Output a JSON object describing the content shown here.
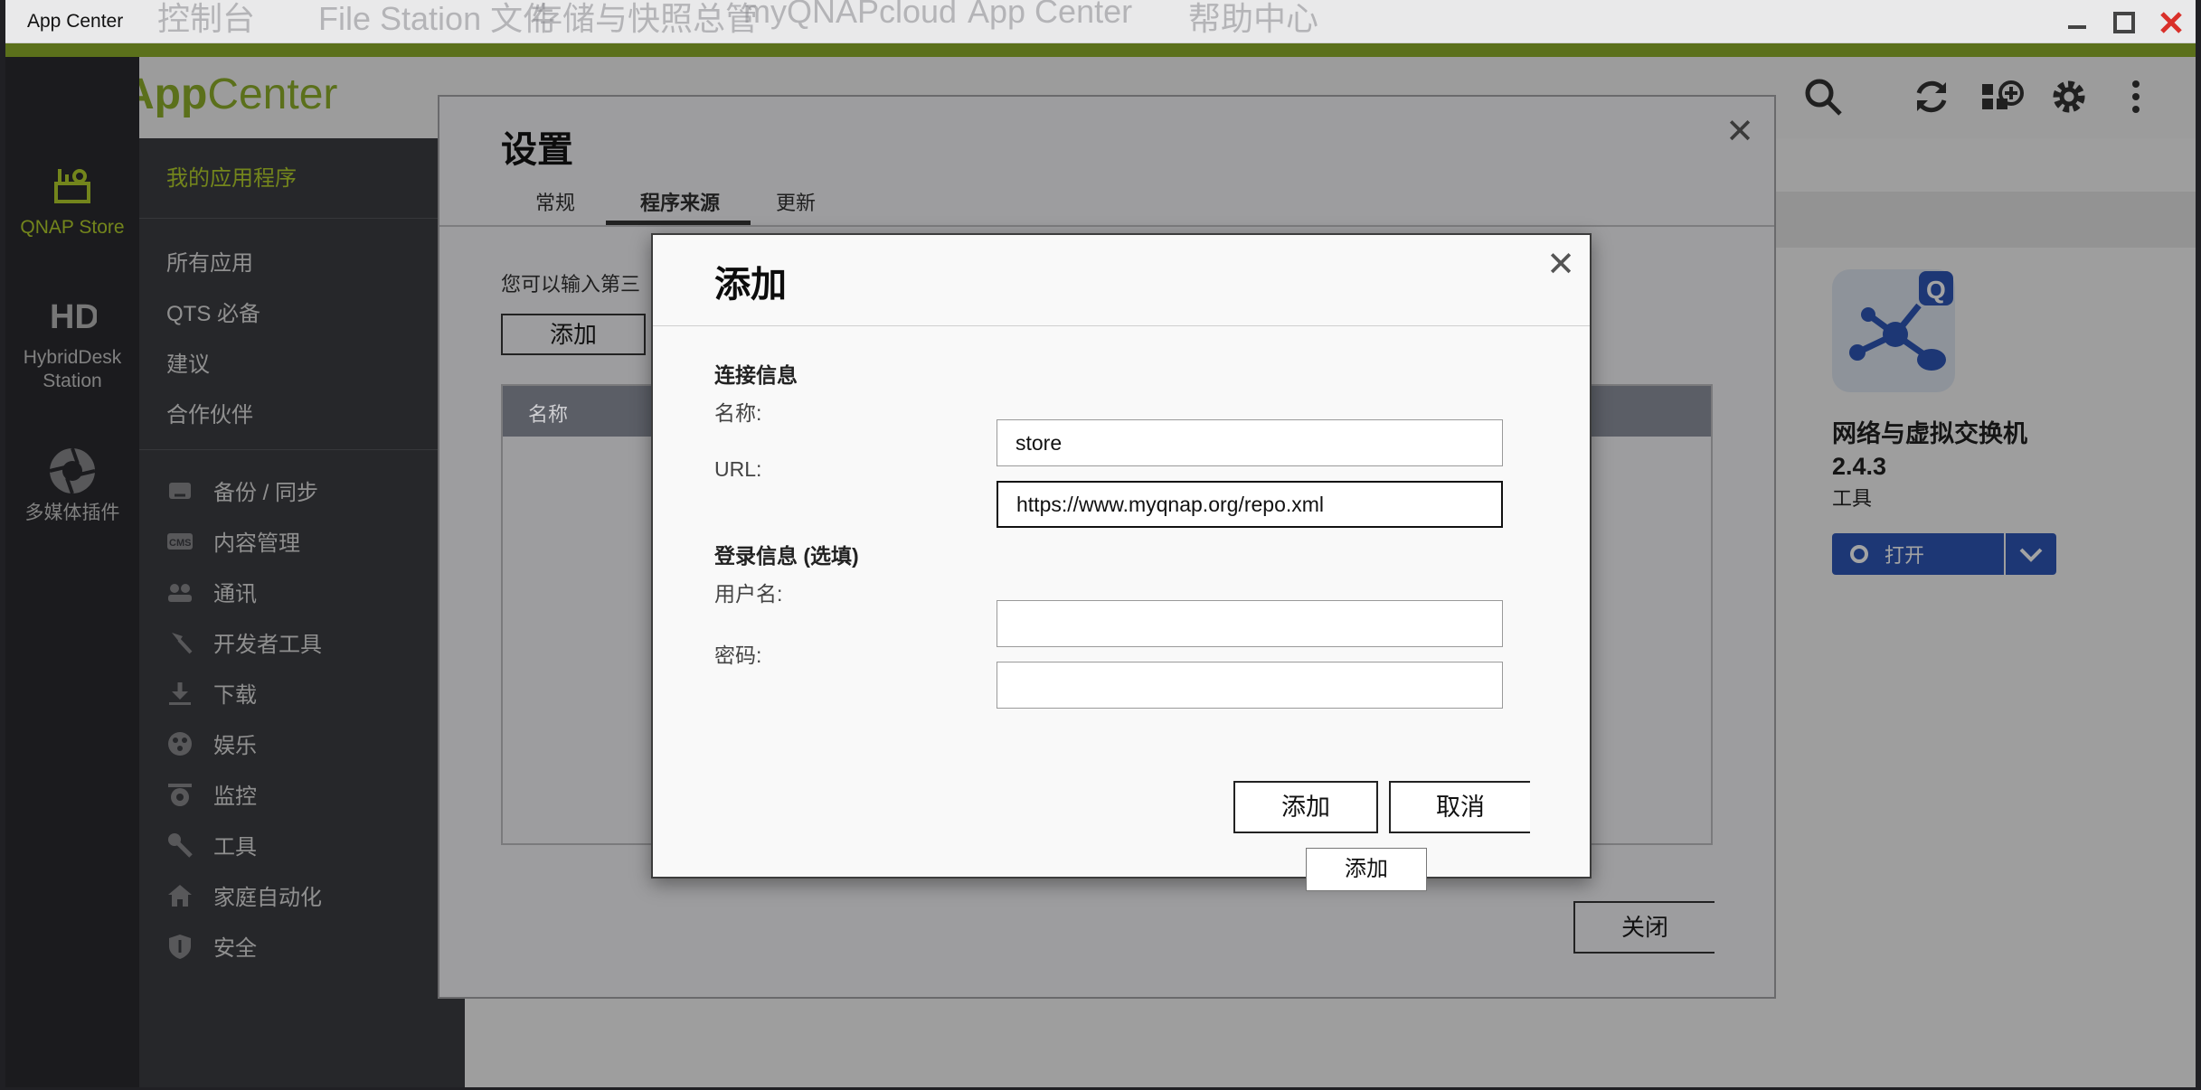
{
  "window": {
    "title": "App Center",
    "ghost_menu": [
      "控制台",
      "File Station 文件",
      "存储与快照总管",
      "myQNAPcloud",
      "App Center",
      "帮助中心"
    ]
  },
  "header": {
    "brand_prefix": "App",
    "brand_suffix": "Center"
  },
  "rail": {
    "items": [
      {
        "label": "QNAP Store",
        "icon": "store-icon",
        "active": true
      },
      {
        "label": "HybridDesk Station",
        "icon": "hybriddesk-icon"
      },
      {
        "label": "多媒体插件",
        "icon": "multimedia-icon"
      }
    ]
  },
  "panel": {
    "my_apps": "我的应用程序",
    "links": [
      "所有应用",
      "QTS 必备",
      "建议",
      "合作伙伴"
    ],
    "categories": [
      {
        "label": "备份 / 同步",
        "icon": "backup-icon"
      },
      {
        "label": "内容管理",
        "icon": "cms-icon"
      },
      {
        "label": "通讯",
        "icon": "communication-icon"
      },
      {
        "label": "开发者工具",
        "icon": "hammer-icon"
      },
      {
        "label": "下载",
        "icon": "download-icon"
      },
      {
        "label": "娱乐",
        "icon": "entertainment-icon"
      },
      {
        "label": "监控",
        "icon": "camera-icon"
      },
      {
        "label": "工具",
        "icon": "wrench-icon"
      },
      {
        "label": "家庭自动化",
        "icon": "home-icon"
      },
      {
        "label": "安全",
        "icon": "shield-icon"
      }
    ]
  },
  "app_card": {
    "name": "网络与虚拟交换机 2.4.3",
    "category": "工具",
    "open_label": "打开",
    "badge": "Q"
  },
  "settings": {
    "title": "设置",
    "tabs": [
      "常规",
      "程序来源",
      "更新"
    ],
    "active_tab": "程序来源",
    "description": "您可以输入第三",
    "add_label": "添加",
    "table_header": "名称",
    "close_label": "关闭"
  },
  "add_dialog": {
    "title": "添加",
    "connection_section": "连接信息",
    "name_label": "名称:",
    "name_value": "store",
    "url_label": "URL:",
    "url_value": "https://www.myqnap.org/repo.xml",
    "login_section": "登录信息 (选填)",
    "username_label": "用户名:",
    "username_value": "",
    "password_label": "密码:",
    "password_value": "",
    "add_button": "添加",
    "cancel_button": "取消",
    "tooltip": "添加"
  },
  "colors": {
    "accent": "#8fb02b",
    "open_button": "#2e56b7",
    "panel": "#3c3d42",
    "rail": "#2b2b2f"
  }
}
